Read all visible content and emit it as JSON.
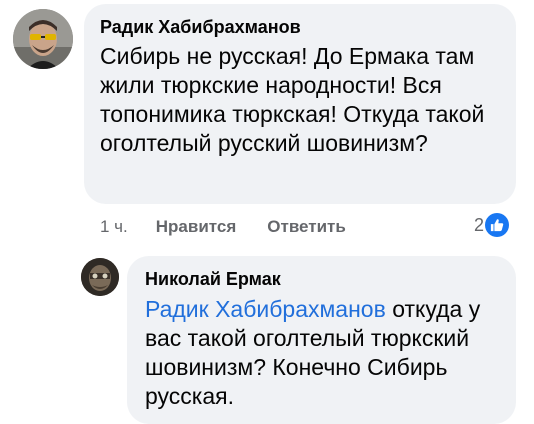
{
  "comments": [
    {
      "author": "Радик Хабибрахманов",
      "text": "Сибирь не русская! До Ермака там жили тюркские  народности! Вся топонимика тюркская! Откуда такой оголтелый русский шовинизм?",
      "time": "1 ч.",
      "like_label": "Нравится",
      "reply_label": "Ответить",
      "reaction_count": "2",
      "reaction_icon": "like-thumb-icon"
    },
    {
      "author": "Николай Ермак",
      "mention": "Радик Хабибрахманов",
      "text": " откуда у вас такой оголтелый тюркский шовинизм? Конечно Сибирь русская."
    }
  ],
  "colors": {
    "bubble": "#f0f2f5",
    "mention": "#216fdb",
    "meta": "#65676b",
    "like_badge": "#1877f2"
  }
}
